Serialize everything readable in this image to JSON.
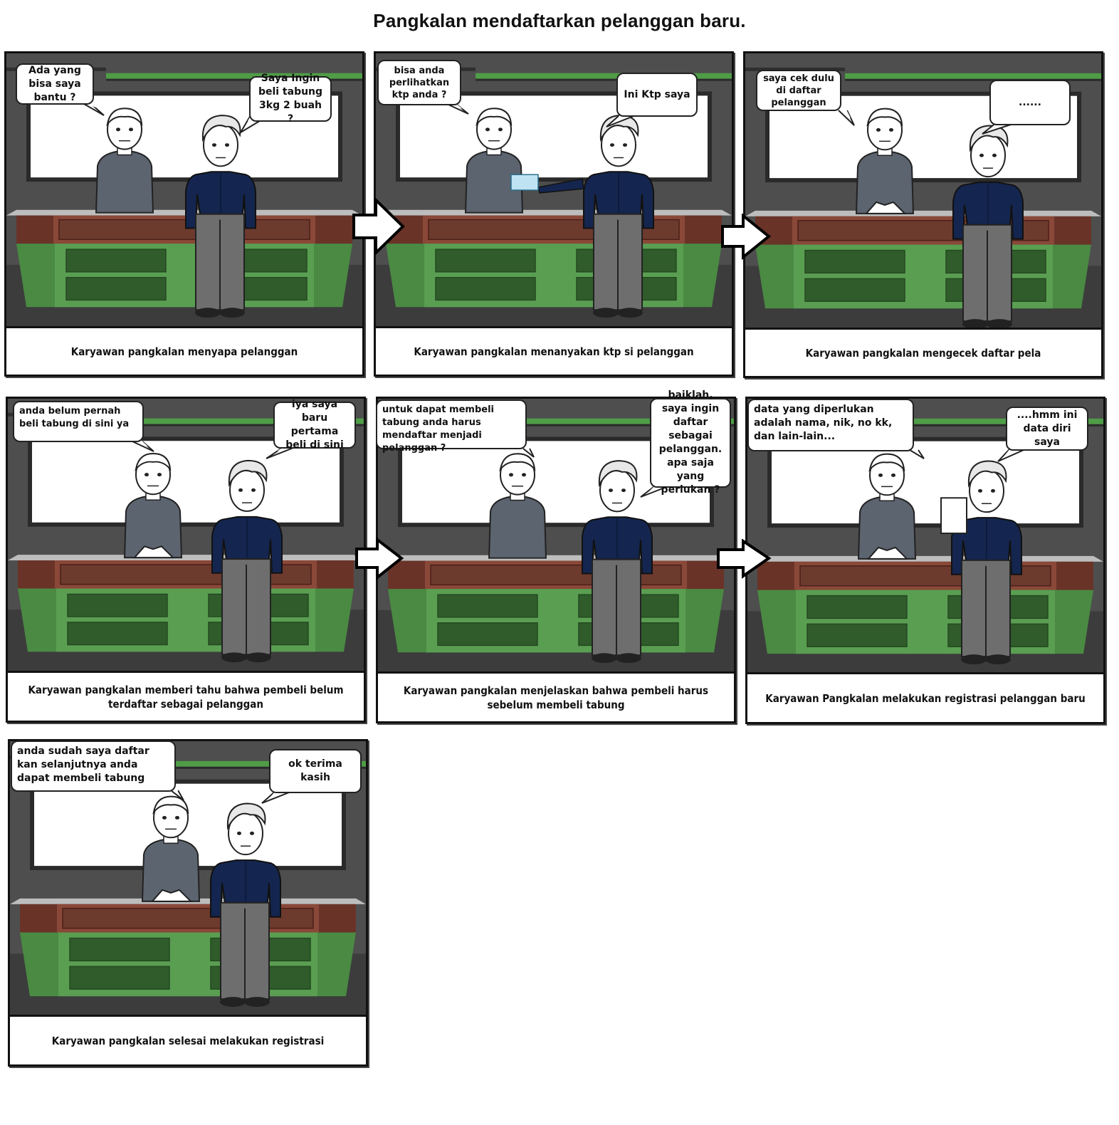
{
  "title": "Pangkalan mendaftarkan pelanggan baru.",
  "panels": [
    {
      "caption": "Karyawan pangkalan menyapa pelanggan",
      "employee_bubble": "Ada  yang bisa saya bantu ?",
      "customer_bubble": "Saya Ingin beli tabung 3kg 2 buah ?"
    },
    {
      "caption": "Karyawan pangkalan menanyakan ktp si pelanggan",
      "employee_bubble": "bisa anda perlihatkan ktp anda ?",
      "customer_bubble": "Ini Ktp saya"
    },
    {
      "caption": "Karyawan pangkalan mengecek daftar pela",
      "employee_bubble": "saya cek dulu di daftar pelanggan",
      "customer_bubble": "......"
    },
    {
      "caption": "Karyawan pangkalan memberi tahu bahwa pembeli belum terdaftar sebagai pelanggan",
      "employee_bubble": "anda belum pernah beli tabung di sini ya",
      "customer_bubble": "iya saya baru pertama beli di sini"
    },
    {
      "caption": "Karyawan pangkalan menjelaskan bahwa pembeli harus sebelum membeli tabung",
      "employee_bubble": "untuk dapat membeli tabung anda harus mendaftar menjadi pelanggan ?",
      "customer_bubble": "baiklah, saya ingin daftar sebagai pelanggan. apa saja yang perlukan ?"
    },
    {
      "caption": "Karyawan Pangkalan melakukan registrasi pelanggan baru",
      "employee_bubble": "data yang diperlukan adalah nama, nik, no kk, dan lain-lain...",
      "customer_bubble": "....hmm ini data diri saya"
    },
    {
      "caption": "Karyawan pangkalan selesai melakukan registrasi",
      "employee_bubble": "anda sudah saya daftar kan selanjutnya anda dapat membeli tabung",
      "customer_bubble": "ok terima kasih"
    }
  ],
  "colors": {
    "wall": "#4e4e4e",
    "green_stripe": "#4f9d47",
    "counter_green": "#5a9e52",
    "counter_top": "#8a4838",
    "employee_sweater": "#5c6470",
    "customer_shirt": "#14264f",
    "customer_pants": "#6e6e6e"
  },
  "icons": [
    "arrow-right-icon",
    "book-icon",
    "id-card-icon",
    "paper-icon"
  ]
}
